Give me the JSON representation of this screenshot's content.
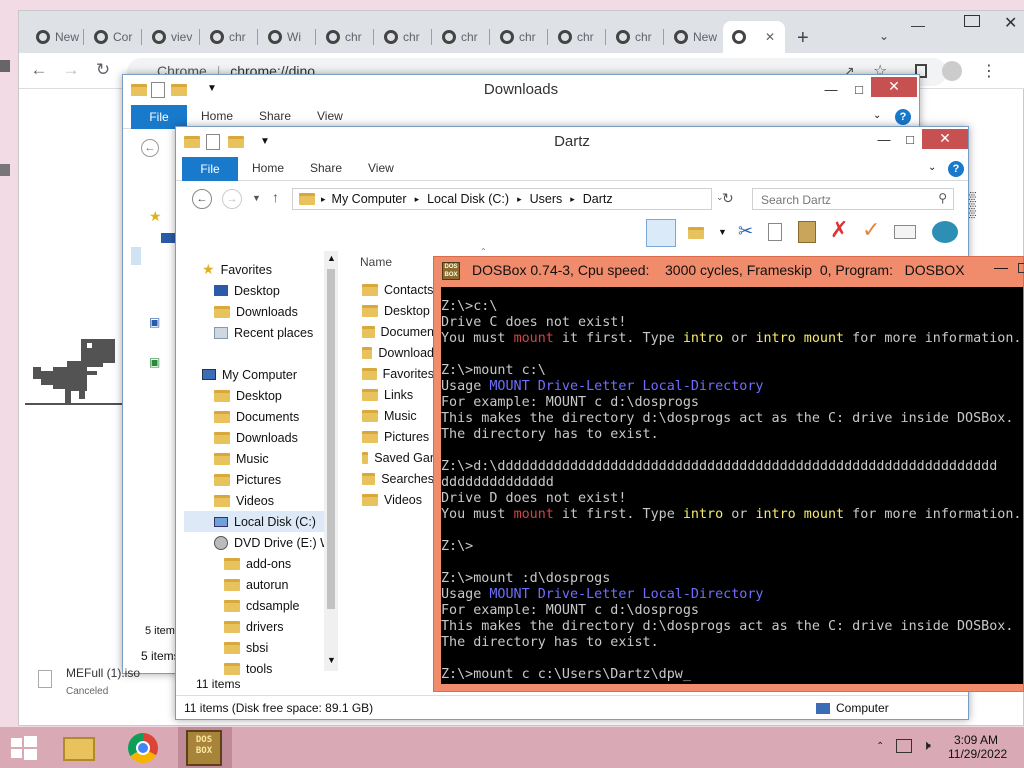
{
  "chrome": {
    "tabs": [
      {
        "label": "New",
        "active": false
      },
      {
        "label": "Cor",
        "active": false
      },
      {
        "label": "viev",
        "active": false
      },
      {
        "label": "chr",
        "active": false
      },
      {
        "label": "Wi",
        "active": false
      },
      {
        "label": "chr",
        "active": false
      },
      {
        "label": "chr",
        "active": false
      },
      {
        "label": "chr",
        "active": false
      },
      {
        "label": "chr",
        "active": false
      },
      {
        "label": "chr",
        "active": false
      },
      {
        "label": "chr",
        "active": false
      },
      {
        "label": "New",
        "active": false
      }
    ],
    "new_tab_symbol": "+",
    "url_scheme": "Chrome",
    "url": "chrome://dino"
  },
  "downloads_window": {
    "title": "Downloads",
    "ribbon_tabs": [
      "File",
      "Home",
      "Share",
      "View"
    ],
    "status_items_1": "5 item",
    "status_items_2": "5 items",
    "download_item": {
      "name": "MEFull (1).iso",
      "status": "Canceled"
    }
  },
  "dartz_window": {
    "title": "Dartz",
    "ribbon_tabs": [
      "File",
      "Home",
      "Share",
      "View"
    ],
    "breadcrumb": [
      "My Computer",
      "Local Disk (C:)",
      "Users",
      "Dartz"
    ],
    "search_placeholder": "Search Dartz",
    "nav": {
      "favorites_header": "Favorites",
      "favorites": [
        "Desktop",
        "Downloads",
        "Recent places"
      ],
      "computer_header": "My Computer",
      "computer_items": [
        "Desktop",
        "Documents",
        "Downloads",
        "Music",
        "Pictures",
        "Videos",
        "Local Disk (C:)",
        "DVD Drive (E:) Wi"
      ],
      "dvd_folders": [
        "add-ons",
        "autorun",
        "cdsample",
        "drivers",
        "sbsi",
        "tools"
      ]
    },
    "column_name": "Name",
    "files": [
      "Contacts",
      "Desktop",
      "Documen",
      "Download",
      "Favorites",
      "Links",
      "Music",
      "Pictures",
      "Saved Gar",
      "Searches",
      "Videos"
    ],
    "items_count": "11 items",
    "status_text": "11 items (Disk free space: 89.1 GB)",
    "status_location": "Computer"
  },
  "dosbox": {
    "title": "DOSBox 0.74-3, Cpu speed:    3000 cycles, Frameskip  0, Program:   DOSBOX",
    "lines": [
      {
        "segments": [
          {
            "t": "Z:\\>c:\\",
            "c": ""
          }
        ]
      },
      {
        "segments": [
          {
            "t": "Drive C does not exist!",
            "c": ""
          }
        ]
      },
      {
        "segments": [
          {
            "t": "You must ",
            "c": ""
          },
          {
            "t": "mount",
            "c": "red"
          },
          {
            "t": " it first. Type ",
            "c": ""
          },
          {
            "t": "intro",
            "c": "yel"
          },
          {
            "t": " or ",
            "c": ""
          },
          {
            "t": "intro mount",
            "c": "yel"
          },
          {
            "t": " for more information.",
            "c": ""
          }
        ]
      },
      {
        "segments": [
          {
            "t": "",
            "c": ""
          }
        ]
      },
      {
        "segments": [
          {
            "t": "Z:\\>mount c:\\",
            "c": ""
          }
        ]
      },
      {
        "segments": [
          {
            "t": "Usage ",
            "c": ""
          },
          {
            "t": "MOUNT Drive-Letter Local-Directory",
            "c": "blu"
          }
        ]
      },
      {
        "segments": [
          {
            "t": "For example: MOUNT c d:\\dosprogs",
            "c": ""
          }
        ]
      },
      {
        "segments": [
          {
            "t": "This makes the directory d:\\dosprogs act as the C: drive inside DOSBox.",
            "c": ""
          }
        ]
      },
      {
        "segments": [
          {
            "t": "The directory has to exist.",
            "c": ""
          }
        ]
      },
      {
        "segments": [
          {
            "t": "",
            "c": ""
          }
        ]
      },
      {
        "segments": [
          {
            "t": "Z:\\>d:\\dddddddddddddddddddddddddddddddddddddddddddddddddddddddddddddd",
            "c": ""
          }
        ]
      },
      {
        "segments": [
          {
            "t": "dddddddddddddd",
            "c": ""
          }
        ]
      },
      {
        "segments": [
          {
            "t": "Drive D does not exist!",
            "c": ""
          }
        ]
      },
      {
        "segments": [
          {
            "t": "You must ",
            "c": ""
          },
          {
            "t": "mount",
            "c": "red"
          },
          {
            "t": " it first. Type ",
            "c": ""
          },
          {
            "t": "intro",
            "c": "yel"
          },
          {
            "t": " or ",
            "c": ""
          },
          {
            "t": "intro mount",
            "c": "yel"
          },
          {
            "t": " for more information.",
            "c": ""
          }
        ]
      },
      {
        "segments": [
          {
            "t": "",
            "c": ""
          }
        ]
      },
      {
        "segments": [
          {
            "t": "Z:\\>",
            "c": ""
          }
        ]
      },
      {
        "segments": [
          {
            "t": "",
            "c": ""
          }
        ]
      },
      {
        "segments": [
          {
            "t": "Z:\\>mount :d\\dosprogs",
            "c": ""
          }
        ]
      },
      {
        "segments": [
          {
            "t": "Usage ",
            "c": ""
          },
          {
            "t": "MOUNT Drive-Letter Local-Directory",
            "c": "blu"
          }
        ]
      },
      {
        "segments": [
          {
            "t": "For example: MOUNT c d:\\dosprogs",
            "c": ""
          }
        ]
      },
      {
        "segments": [
          {
            "t": "This makes the directory d:\\dosprogs act as the C: drive inside DOSBox.",
            "c": ""
          }
        ]
      },
      {
        "segments": [
          {
            "t": "The directory has to exist.",
            "c": ""
          }
        ]
      },
      {
        "segments": [
          {
            "t": "",
            "c": ""
          }
        ]
      },
      {
        "segments": [
          {
            "t": "Z:\\>mount c c:\\Users\\Dartz\\dpw_",
            "c": ""
          }
        ]
      }
    ],
    "colors": {
      "red": "#d24545",
      "yellow": "#f4ec6a",
      "blue": "#6f6dff",
      "title_bar": "#f08b6b"
    }
  },
  "taskbar": {
    "time": "3:09 AM",
    "date": "11/29/2022",
    "dosbox_icon_text": "DOS BOX"
  }
}
